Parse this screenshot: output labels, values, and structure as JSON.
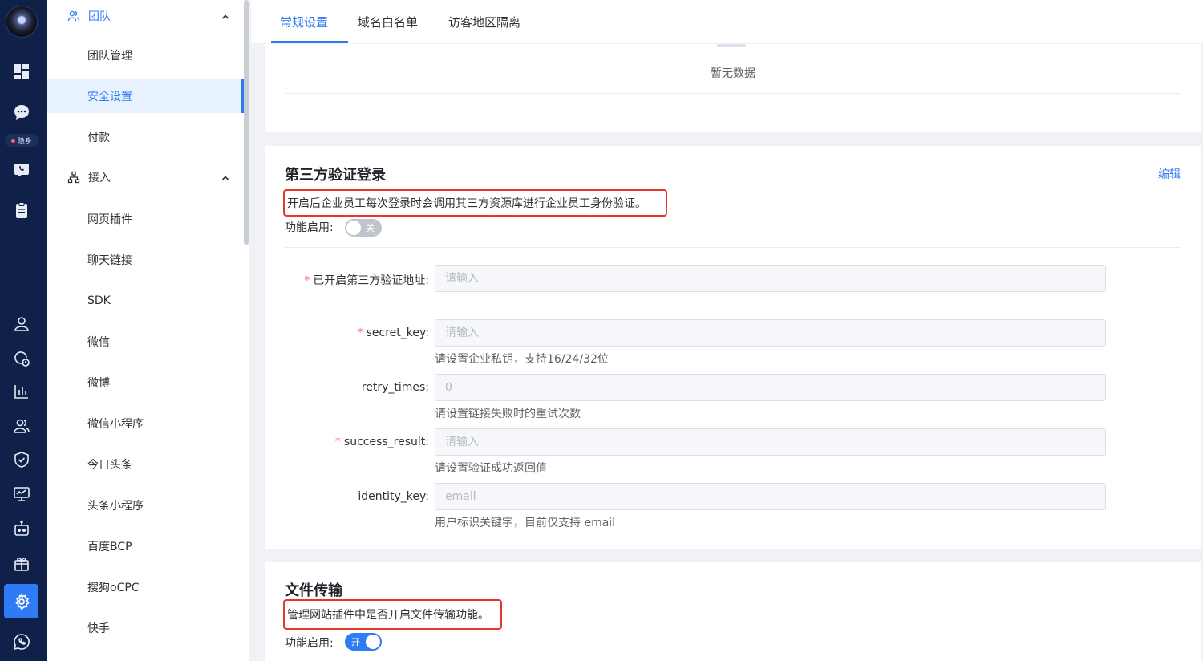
{
  "rail": {
    "status_label": "隐身",
    "icons": [
      "dashboard-icon",
      "chat-icon",
      "phone-chat-icon",
      "clipboard-icon",
      "user-icon",
      "history-chat-icon",
      "bar-chart-icon",
      "team-icon",
      "shield-icon",
      "monitor-chart-icon",
      "robot-icon",
      "package-icon",
      "gear-icon",
      "whatsapp-icon"
    ],
    "accent": "#2f7bf6",
    "background": "#0f2149"
  },
  "sidebar": {
    "group_team": "团队",
    "items_team": [
      "团队管理",
      "安全设置",
      "付款"
    ],
    "active_item": "安全设置",
    "group_access": "接入",
    "items_access": [
      "网页插件",
      "聊天链接",
      "SDK",
      "微信",
      "微博",
      "微信小程序",
      "今日头条",
      "头条小程序",
      "百度BCP",
      "搜狗oCPC",
      "快手"
    ]
  },
  "tabs": [
    "常规设置",
    "域名白名单",
    "访客地区隔离"
  ],
  "active_tab": "常规设置",
  "whitelist": {
    "empty_text": "暂无数据"
  },
  "third_party": {
    "title": "第三方验证登录",
    "edit": "编辑",
    "description": "开启后企业员工每次登录时会调用其三方资源库进行企业员工身份验证。",
    "enable_label": "功能启用:",
    "switch_text": "关",
    "enabled": false,
    "fields": [
      {
        "label": "已开启第三方验证地址",
        "required": true,
        "value": "",
        "placeholder": "请输入",
        "hint": ""
      },
      {
        "label": "secret_key",
        "required": true,
        "value": "",
        "placeholder": "请输入",
        "hint": "请设置企业私钥，支持16/24/32位"
      },
      {
        "label": "retry_times",
        "required": false,
        "value": "",
        "placeholder": "0",
        "hint": "请设置链接失败时的重试次数"
      },
      {
        "label": "success_result",
        "required": true,
        "value": "",
        "placeholder": "请输入",
        "hint": "请设置验证成功返回值"
      },
      {
        "label": "identity_key",
        "required": false,
        "value": "",
        "placeholder": "email",
        "hint": "用户标识关键字，目前仅支持 email"
      }
    ]
  },
  "file_transfer": {
    "title": "文件传输",
    "description": "管理网站插件中是否开启文件传输功能。",
    "enable_label": "功能启用:",
    "switch_text": "开",
    "enabled": true
  }
}
